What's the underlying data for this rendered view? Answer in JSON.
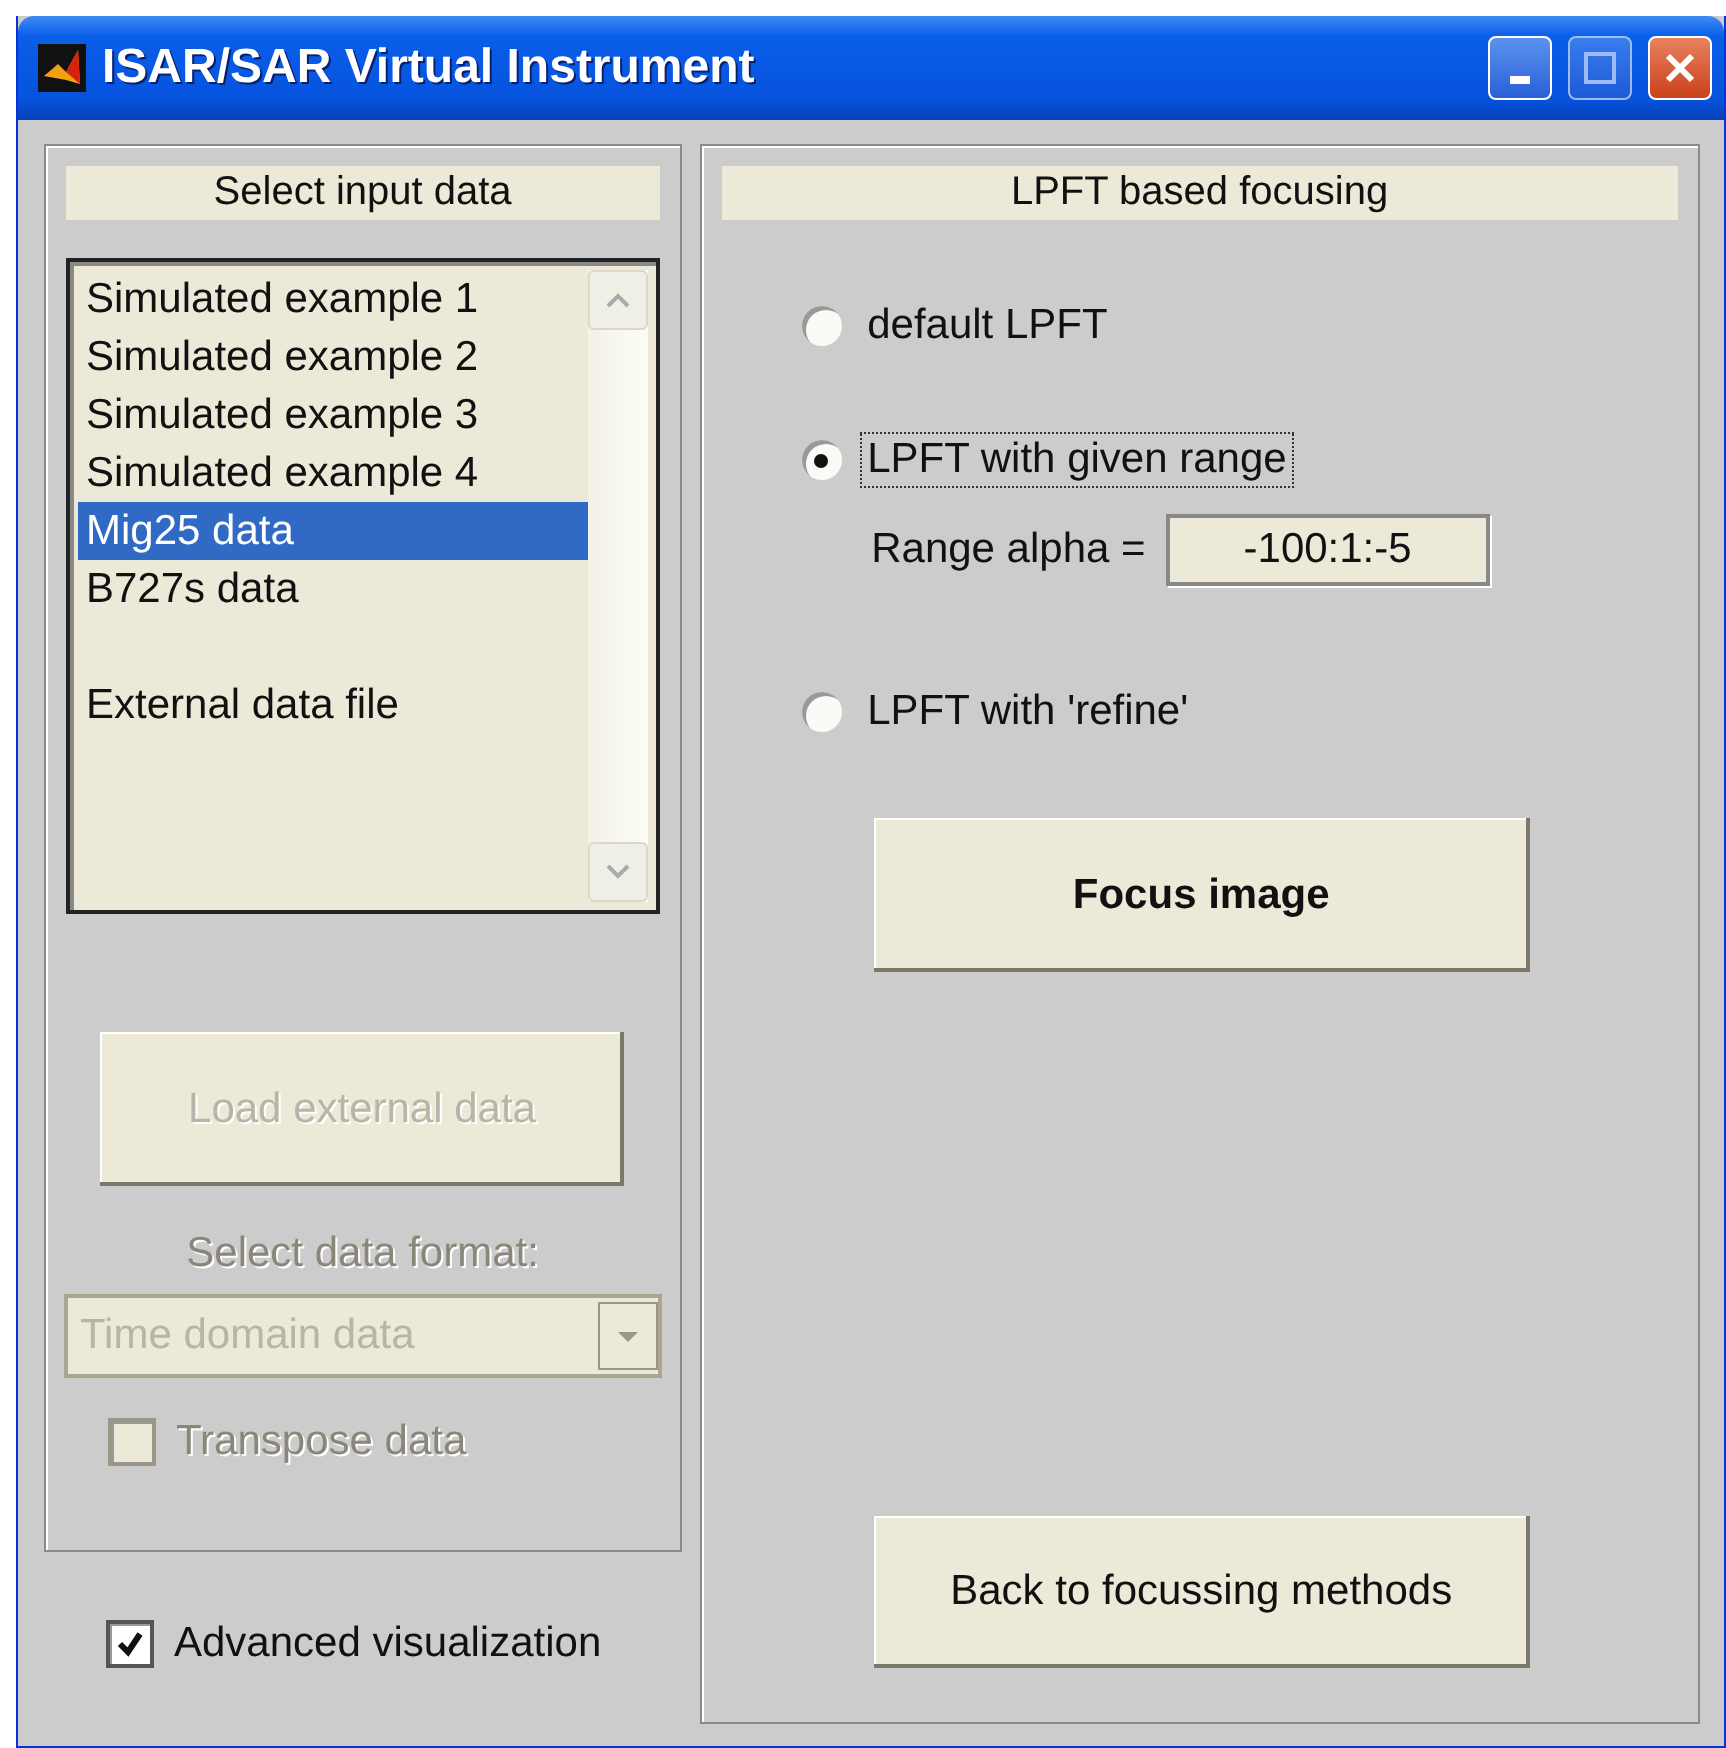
{
  "window": {
    "title": "ISAR/SAR Virtual Instrument"
  },
  "input_panel": {
    "title": "Select input data",
    "items": [
      {
        "label": "Simulated example 1",
        "selected": false
      },
      {
        "label": "Simulated example 2",
        "selected": false
      },
      {
        "label": "Simulated example 3",
        "selected": false
      },
      {
        "label": "Simulated example 4",
        "selected": false
      },
      {
        "label": "Mig25 data",
        "selected": true
      },
      {
        "label": "B727s data",
        "selected": false
      },
      {
        "selected": false
      },
      {
        "label": "External data file",
        "selected": false
      }
    ],
    "load_button": {
      "label": "Load external data",
      "disabled": true
    },
    "format_label": {
      "text": "Select data format:",
      "disabled": true
    },
    "format_dropdown": {
      "value": "Time domain data",
      "disabled": true
    },
    "transpose": {
      "label": "Transpose data",
      "checked": false,
      "disabled": true
    }
  },
  "advanced_visualization": {
    "label": "Advanced visualization",
    "checked": true
  },
  "focus_panel": {
    "title": "LPFT based focusing",
    "options": [
      {
        "label": "default LPFT",
        "selected": false
      },
      {
        "label": "LPFT with given range",
        "selected": true
      },
      {
        "label": "LPFT with 'refine'",
        "selected": false
      }
    ],
    "range": {
      "label": "Range alpha =",
      "value": "-100:1:-5"
    },
    "focus_button": {
      "label": "Focus image"
    },
    "back_button": {
      "label": "Back to focussing methods"
    }
  }
}
